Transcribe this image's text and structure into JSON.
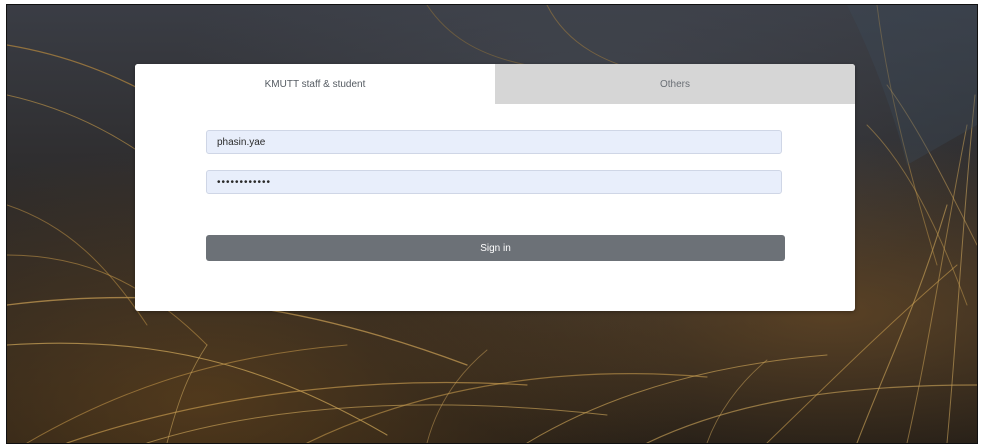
{
  "tabs": {
    "active_label": "KMUTT staff & student",
    "inactive_label": "Others"
  },
  "form": {
    "username_value": "phasin.yae",
    "password_value": "••••••••••••",
    "signin_label": "Sign in"
  },
  "colors": {
    "tab_inactive_bg": "#d6d6d6",
    "input_bg": "#e8eefb",
    "button_bg": "#6c7177",
    "card_bg": "#ffffff"
  }
}
